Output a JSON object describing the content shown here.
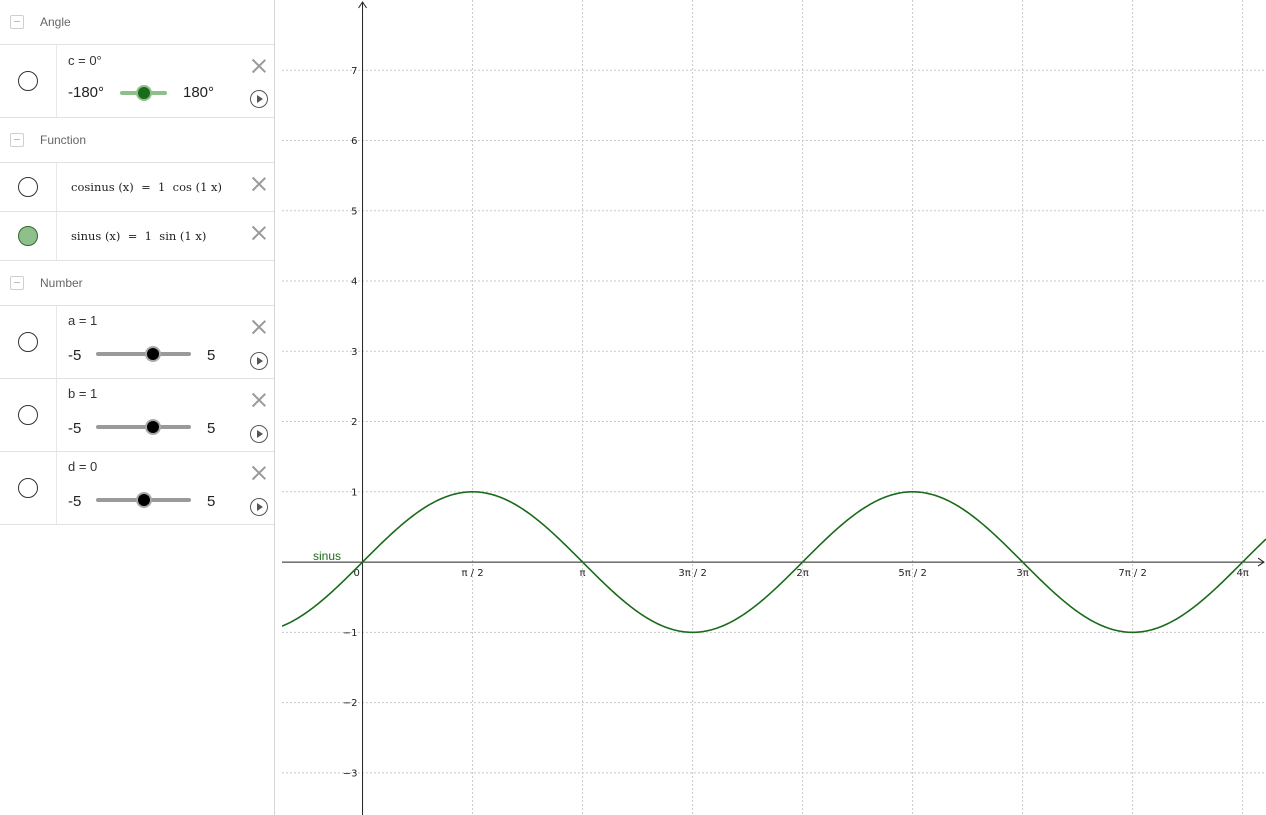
{
  "algebra": {
    "groups": [
      {
        "title": "Angle"
      },
      {
        "title": "Function"
      },
      {
        "title": "Number"
      }
    ],
    "angle_slider": {
      "label": "c = 0°",
      "min": "-180°",
      "max": "180°",
      "value_fraction": 0.5,
      "visible": false
    },
    "functions": [
      {
        "text": "cosinus (x)  =  1  cos (1 x)",
        "visible": false
      },
      {
        "text": "sinus (x)  =  1  sin (1 x)",
        "visible": true
      }
    ],
    "number_sliders": [
      {
        "label": "a = 1",
        "min": "-5",
        "max": "5",
        "value": 1,
        "range": [
          -5,
          5
        ]
      },
      {
        "label": "b = 1",
        "min": "-5",
        "max": "5",
        "value": 1,
        "range": [
          -5,
          5
        ]
      },
      {
        "label": "d = 0",
        "min": "-5",
        "max": "5",
        "value": 0,
        "range": [
          -5,
          5
        ]
      }
    ]
  },
  "colors": {
    "function_curve": "#1a6b1a",
    "toggle_on": "#8fbf8b",
    "grid": "#c9c9c9",
    "axis": "#222222"
  },
  "graph": {
    "curve_label": "sinus",
    "x_ticks": [
      "0",
      "π / 2",
      "π",
      "3π / 2",
      "2π",
      "5π / 2",
      "3π",
      "7π / 2",
      "4π"
    ],
    "y_ticks_pos": [
      "1",
      "2",
      "3",
      "4",
      "5",
      "6",
      "7"
    ],
    "y_ticks_neg": [
      "−1",
      "−2",
      "−3"
    ]
  },
  "chart_data": {
    "type": "line",
    "series": [
      {
        "name": "sinus",
        "function": "sin(x)",
        "color": "#1a6b1a"
      }
    ],
    "xlim": [
      -1.15,
      12.9
    ],
    "ylim": [
      -3.6,
      8
    ],
    "x_tick_values": [
      0,
      1.5708,
      3.1416,
      4.7124,
      6.2832,
      7.854,
      9.4248,
      10.9956,
      12.5664
    ],
    "y_tick_values": [
      -3,
      -2,
      -1,
      1,
      2,
      3,
      4,
      5,
      6,
      7
    ],
    "grid": true
  }
}
